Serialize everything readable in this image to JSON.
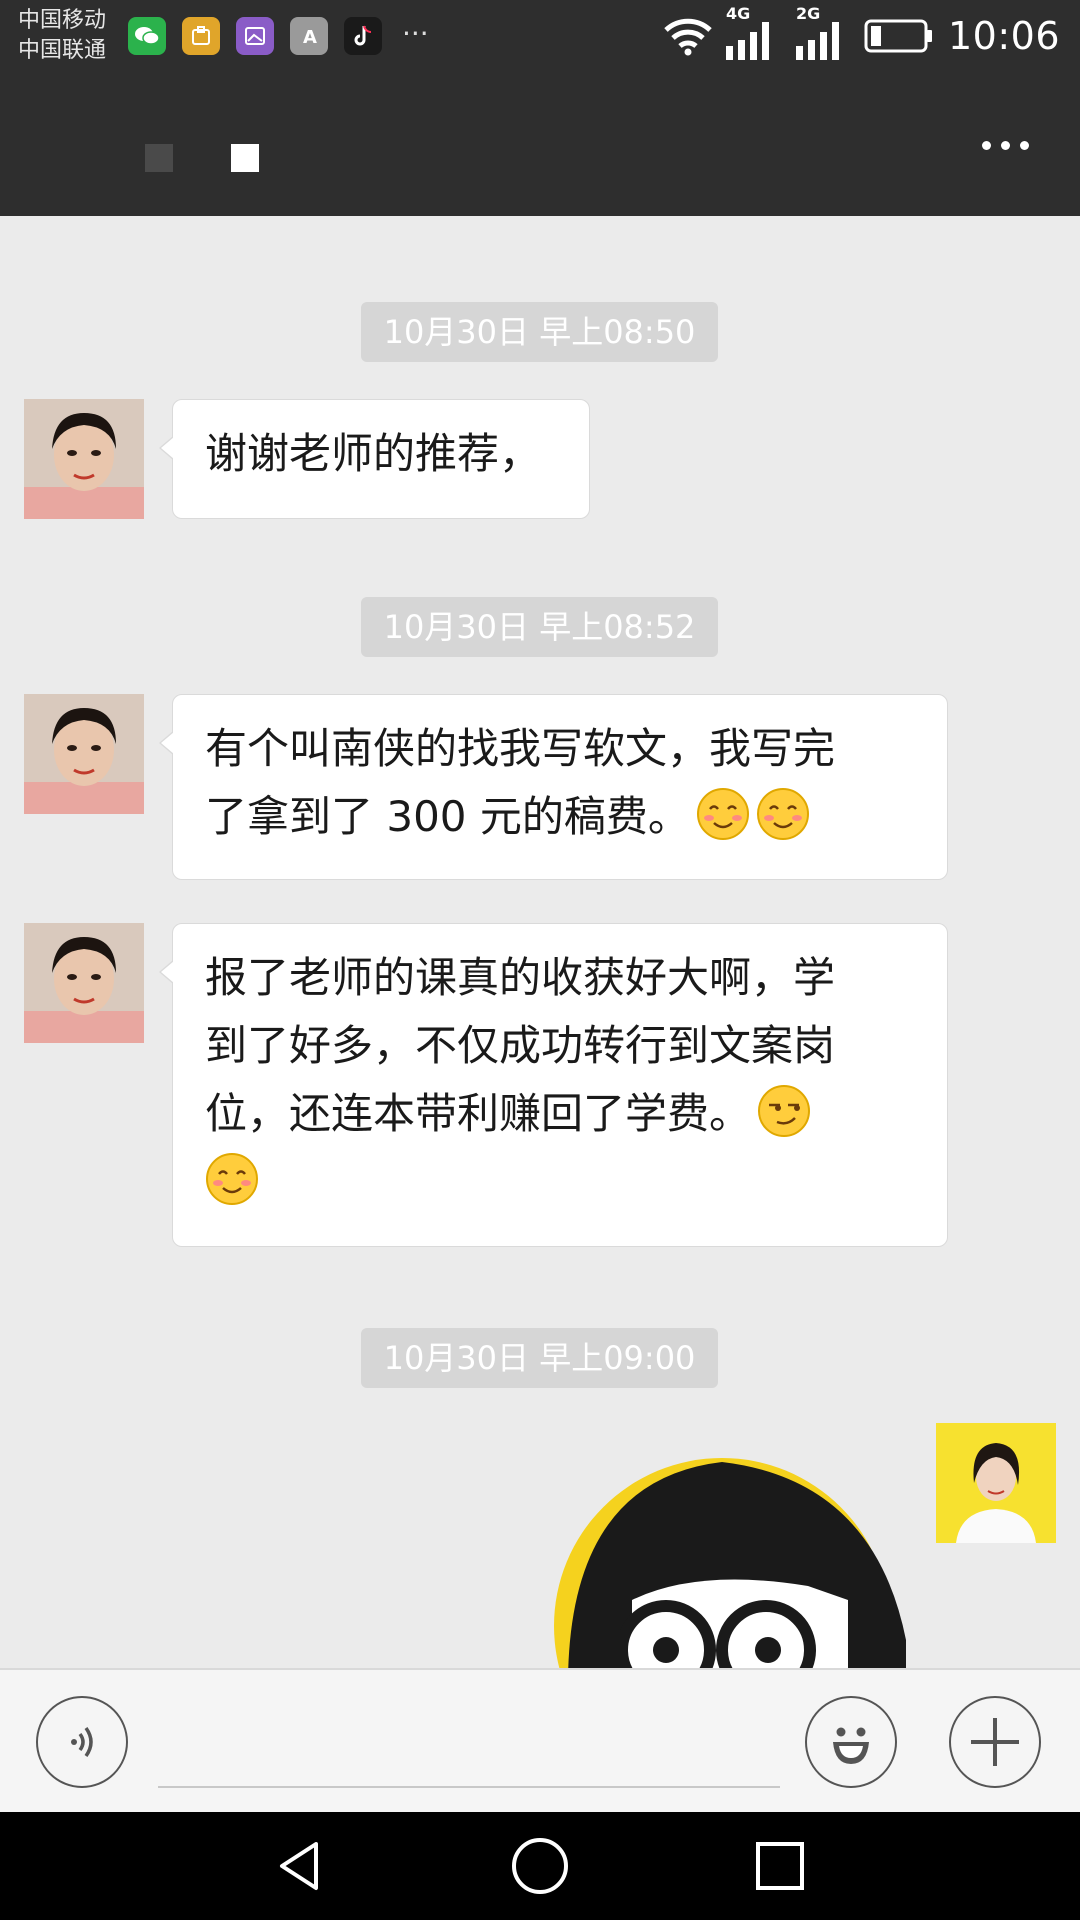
{
  "status_bar": {
    "carrier_1": "中国移动",
    "carrier_2": "中国联通",
    "notification_icons": [
      "wechat-icon",
      "wallet-icon",
      "gallery-icon",
      "font-icon",
      "tiktok-icon"
    ],
    "more_indicator": "···",
    "network_1": "4G",
    "network_2": "2G",
    "time": "10:06",
    "battery_level": 0.2
  },
  "title_bar": {
    "title_obscured": true
  },
  "messages": [
    {
      "timestamp": "10月30日 早上08:50",
      "text": "谢谢老师的推荐，",
      "emojis": []
    },
    {
      "timestamp": "10月30日 早上08:52",
      "lines": [
        "有个叫南侠的找我写软文，我写完",
        "了拿到了 300 元的稿费。"
      ],
      "emojis": [
        "blush",
        "blush"
      ]
    },
    {
      "lines": [
        "报了老师的课真的收获好大啊，学",
        "到了好多，不仅成功转行到文案岗",
        "位，还连本带利赚回了学费。"
      ],
      "emojis": [
        "smirk",
        "blush"
      ]
    },
    {
      "timestamp": "10月30日 早上09:00",
      "sticker": "cartoon-girl-glasses"
    }
  ],
  "colors": {
    "header_bg": "#2e2e2e",
    "chat_bg": "#ebebeb",
    "timestamp_bg": "#d6d6d6",
    "sticker_yellow": "#f5d21e"
  }
}
